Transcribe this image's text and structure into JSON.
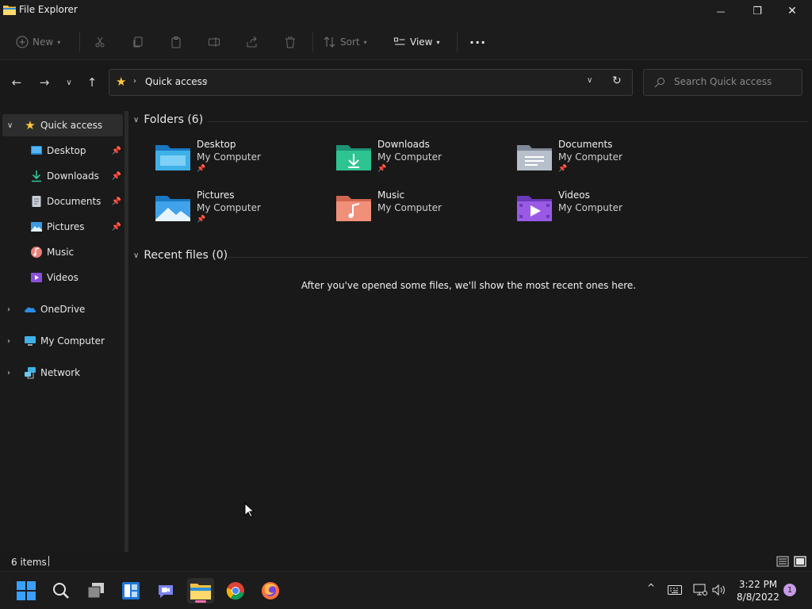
{
  "window": {
    "title": "File Explorer",
    "minimize_glyph": "—",
    "maximize_glyph": "❐",
    "close_glyph": "✕"
  },
  "toolbar": {
    "new_label": "New",
    "sort_label": "Sort",
    "view_label": "View",
    "more_glyph": "···"
  },
  "address": {
    "location": "Quick access",
    "search_placeholder": "Search Quick access"
  },
  "sidebar": {
    "quick_access": "Quick access",
    "items": [
      {
        "label": "Desktop",
        "icon": "desktop-icon",
        "pinned": true
      },
      {
        "label": "Downloads",
        "icon": "downloads-icon",
        "pinned": true
      },
      {
        "label": "Documents",
        "icon": "documents-icon",
        "pinned": true
      },
      {
        "label": "Pictures",
        "icon": "pictures-icon",
        "pinned": true
      },
      {
        "label": "Music",
        "icon": "music-icon",
        "pinned": false
      },
      {
        "label": "Videos",
        "icon": "videos-icon",
        "pinned": false
      }
    ],
    "roots": [
      {
        "label": "OneDrive",
        "icon": "onedrive-icon"
      },
      {
        "label": "My Computer",
        "icon": "computer-icon"
      },
      {
        "label": "Network",
        "icon": "network-icon"
      }
    ]
  },
  "content": {
    "folders_heading": "Folders (6)",
    "folders": [
      {
        "name": "Desktop",
        "location": "My Computer",
        "pinned": true,
        "icon": "desktop-folder-icon"
      },
      {
        "name": "Downloads",
        "location": "My Computer",
        "pinned": true,
        "icon": "downloads-folder-icon"
      },
      {
        "name": "Documents",
        "location": "My Computer",
        "pinned": true,
        "icon": "documents-folder-icon"
      },
      {
        "name": "Pictures",
        "location": "My Computer",
        "pinned": true,
        "icon": "pictures-folder-icon"
      },
      {
        "name": "Music",
        "location": "My Computer",
        "pinned": false,
        "icon": "music-folder-icon"
      },
      {
        "name": "Videos",
        "location": "My Computer",
        "pinned": false,
        "icon": "videos-folder-icon"
      }
    ],
    "recent_heading": "Recent files (0)",
    "recent_empty": "After you've opened some files, we'll show the most recent ones here."
  },
  "status": {
    "item_count": "6 items"
  },
  "taskbar": {
    "time": "3:22 PM",
    "date": "8/8/2022",
    "notification_count": "1"
  },
  "colors": {
    "accent": "#ffc83d",
    "selection": "#2d2d2d",
    "background": "#191919"
  }
}
